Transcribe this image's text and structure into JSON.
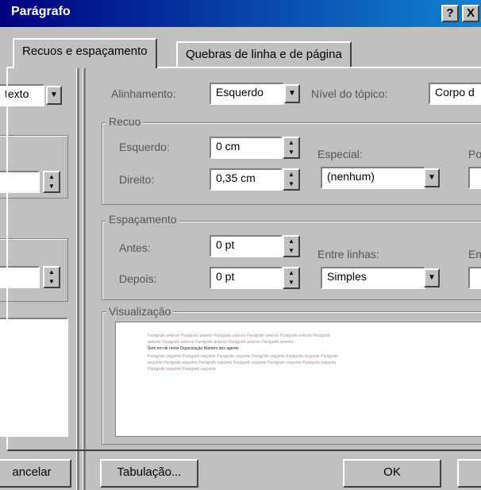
{
  "window": {
    "title": "Parágrafo",
    "help_btn": "?",
    "close_btn": "X"
  },
  "tabs": [
    {
      "label": "Recuos e espaçamento",
      "active": true
    },
    {
      "label": "Quebras de linha e de página",
      "active": false
    }
  ],
  "left_panel": {
    "style_value": "texto",
    "button_cancel": "ancelar"
  },
  "alignment": {
    "label": "Alinhamento:",
    "value": "Esquerdo"
  },
  "outline": {
    "label": "Nível do tópico:",
    "value": "Corpo d"
  },
  "indent": {
    "legend": "Recuo",
    "left_label": "Esquerdo:",
    "left_value": "0 cm",
    "right_label": "Direito:",
    "right_value": "0,35 cm",
    "special_label": "Especial:",
    "special_value": "(nenhum)",
    "by_label": "Po"
  },
  "spacing": {
    "legend": "Espaçamento",
    "before_label": "Antes:",
    "before_value": "0 pt",
    "after_label": "Depois:",
    "after_value": "0 pt",
    "line_label": "Entre linhas:",
    "line_value": "Simples",
    "at_label": "Em"
  },
  "preview": {
    "legend": "Visualização",
    "lines": [
      "Parágrafo anterior Parágrafo anterior Parágrafo anterior Parágrafo anterior Parágrafo anterior Parágrafo",
      "anterior Parágrafo anterior Parágrafo anterior Parágrafo anterior Parágrafo anterior",
      "Som em de nome Organização Número dos agente",
      "Parágrafo seguinte Parágrafo seguinte Parágrafo seguinte Parágrafo seguinte Parágrafo seguinte Parágrafo",
      "seguinte Parágrafo seguinte Parágrafo seguinte Parágrafo seguinte Parágrafo seguinte Parágrafo seguinte",
      "Parágrafo seguinte Parágrafo seguinte"
    ]
  },
  "buttons": {
    "tabs": "Tabulação...",
    "ok": "OK"
  },
  "icons": {
    "spin_up": "▲",
    "spin_down": "▼",
    "dropdown": "▼"
  }
}
